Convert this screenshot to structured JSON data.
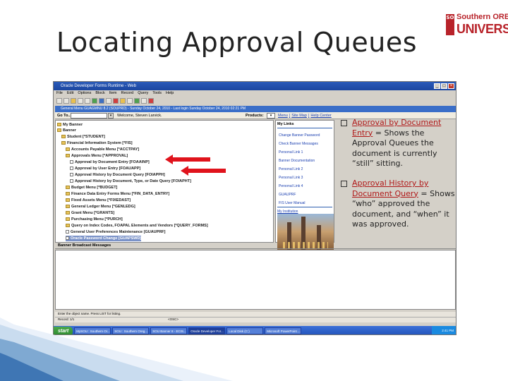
{
  "slide": {
    "title": "Locating Approval Queues"
  },
  "logo": {
    "seal_text": "SO",
    "top_text": "Southern OREGON",
    "bottom_text": "UNIVERSITY"
  },
  "window": {
    "title": "Oracle Developer Forms Runtime - Web",
    "menu": [
      "File",
      "Edit",
      "Options",
      "Block",
      "Item",
      "Record",
      "Query",
      "Tools",
      "Help"
    ]
  },
  "form": {
    "title": "General Menu  GUAGMNU  8.2  (SOUPRD) - Sunday October 24, 2010 - Last login Sunday October 24, 2010 02:21 PM",
    "goto_label": "Go To...",
    "welcome": "Welcome, Steven Larvick.",
    "products_label": "Products:",
    "top_links": [
      "Menu",
      "|",
      "Site Map",
      "|",
      "Help Center"
    ]
  },
  "tree": {
    "items": [
      {
        "label": "My Banner",
        "type": "folder"
      },
      {
        "label": "Banner",
        "type": "folder"
      },
      {
        "label": "Student [*STUDENT]",
        "type": "folder"
      },
      {
        "label": "Financial Information System [*FIS]",
        "type": "folder"
      },
      {
        "label": "Accounts Payable Menu [*ACCTPAY]",
        "type": "folder"
      },
      {
        "label": "Approvals Menu [*APPROVAL]",
        "type": "folder"
      },
      {
        "label": "Approval by Document Entry [FOAAINP]",
        "type": "doc"
      },
      {
        "label": "Approval by User Entry [FOAUAPP]",
        "type": "doc"
      },
      {
        "label": "Approval History by Document Query [FOIAPPH]",
        "type": "doc"
      },
      {
        "label": "Approval History by Document, Type, or Date Query [FOIAPHT]",
        "type": "doc"
      },
      {
        "label": "Budget Menu [*BUDGET]",
        "type": "folder"
      },
      {
        "label": "Finance Data Entry Forms Menu [*FIN_DATA_ENTRY]",
        "type": "folder"
      },
      {
        "label": "Fixed Assets Menu [*FIXEDAST]",
        "type": "folder"
      },
      {
        "label": "General Ledger Menu [*GENLEDG]",
        "type": "folder"
      },
      {
        "label": "Grant Menu [*GRANTS]",
        "type": "folder"
      },
      {
        "label": "Purchasing Menu [*PURCH]",
        "type": "folder"
      },
      {
        "label": "Query on Index Codes, FOAPAL Elements and Vendors [*QUERY_FORMS]",
        "type": "folder"
      },
      {
        "label": "General User Preferences Maintenance [GUAUPRF]",
        "type": "doc"
      },
      {
        "label": "Oracle Password Change [GUAPSWD]",
        "type": "doc"
      }
    ]
  },
  "links_panel": {
    "heading": "My Links",
    "links": [
      "Change Banner Password",
      "Check Banner Messages",
      "Personal Link 1",
      "Banner Documentation",
      "Personal Link 2",
      "Personal Link 3",
      "Personal Link 4",
      "GUAUPRF",
      "FIS User Manual"
    ],
    "institution": "My Institution"
  },
  "broadcast": {
    "heading": "Banner Broadcast Messages"
  },
  "status": {
    "line1": "Enter the object name. Press LIST for listing.",
    "record": "Record: 1/1",
    "osc": "<OSC>"
  },
  "taskbar": {
    "start": "start",
    "tasks": [
      "MySOU : Southern Or...",
      "SOU : Southern Oreg...",
      "SOU Banner 8 - ECIS...",
      "Oracle Developer For...",
      "Local Disk (C:)",
      "Microsoft PowerPoint ..."
    ],
    "clock": "2:41 PM"
  },
  "bullets": [
    {
      "title": "Approval by Document Entry",
      "text": " = Shows the Approval Queues the document is currently “still” sitting."
    },
    {
      "title": "Approval History by Document Query",
      "text": " = Shows “who” approved the  document, and “when” it was approved."
    }
  ],
  "colors": {
    "accent_red": "#e0131c",
    "brand_red": "#b8232a",
    "link_blue": "#1a3fb0",
    "title_bar": "#2a5ab8"
  }
}
